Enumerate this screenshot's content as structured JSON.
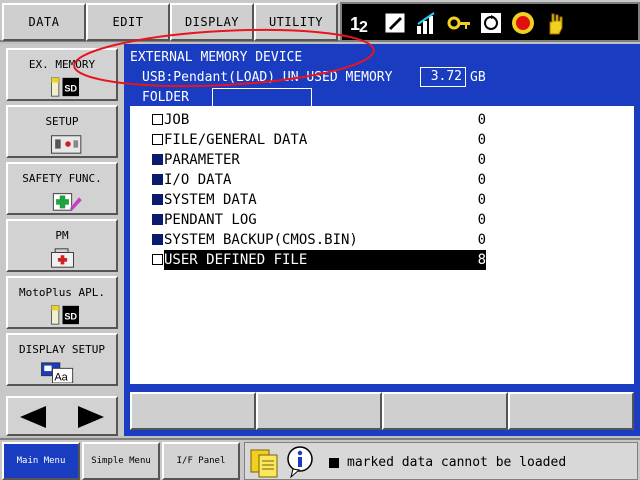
{
  "menu": {
    "data": "DATA",
    "edit": "EDIT",
    "display": "DISPLAY",
    "utility": "UTILITY"
  },
  "status_icons": [
    "tool-number-12-icon",
    "edit-mode-icon",
    "signal-level-icon",
    "key-icon",
    "cycle-icon",
    "stop-icon",
    "hand-icon"
  ],
  "side": {
    "ex_memory": "EX. MEMORY",
    "setup": "SETUP",
    "safety": "SAFETY FUNC.",
    "pm": "PM",
    "motoplus": "MotoPlus APL.",
    "display_setup": "DISPLAY SETUP"
  },
  "main": {
    "header": "EXTERNAL MEMORY DEVICE",
    "usb": "USB:Pendant(LOAD)  UN-USED MEMORY",
    "memory_value": "3.72",
    "memory_unit": "GB",
    "folder_label": "FOLDER",
    "items": [
      {
        "name": "JOB",
        "count": "0",
        "marked": false,
        "selected": false
      },
      {
        "name": "FILE/GENERAL DATA",
        "count": "0",
        "marked": false,
        "selected": false
      },
      {
        "name": "PARAMETER",
        "count": "0",
        "marked": true,
        "selected": false
      },
      {
        "name": "I/O DATA",
        "count": "0",
        "marked": true,
        "selected": false
      },
      {
        "name": "SYSTEM DATA",
        "count": "0",
        "marked": true,
        "selected": false
      },
      {
        "name": "PENDANT LOG",
        "count": "0",
        "marked": true,
        "selected": false
      },
      {
        "name": "SYSTEM BACKUP(CMOS.BIN)",
        "count": "0",
        "marked": true,
        "selected": false
      },
      {
        "name": "USER DEFINED FILE",
        "count": "8",
        "marked": false,
        "selected": true
      }
    ]
  },
  "bottom": {
    "main_menu": "Main Menu",
    "simple_menu": "Simple Menu",
    "if_panel": "I/F Panel",
    "message": "marked data cannot be loaded"
  },
  "colors": {
    "accent_blue": "#1a3cc0",
    "annotation_red": "#e8141e"
  }
}
